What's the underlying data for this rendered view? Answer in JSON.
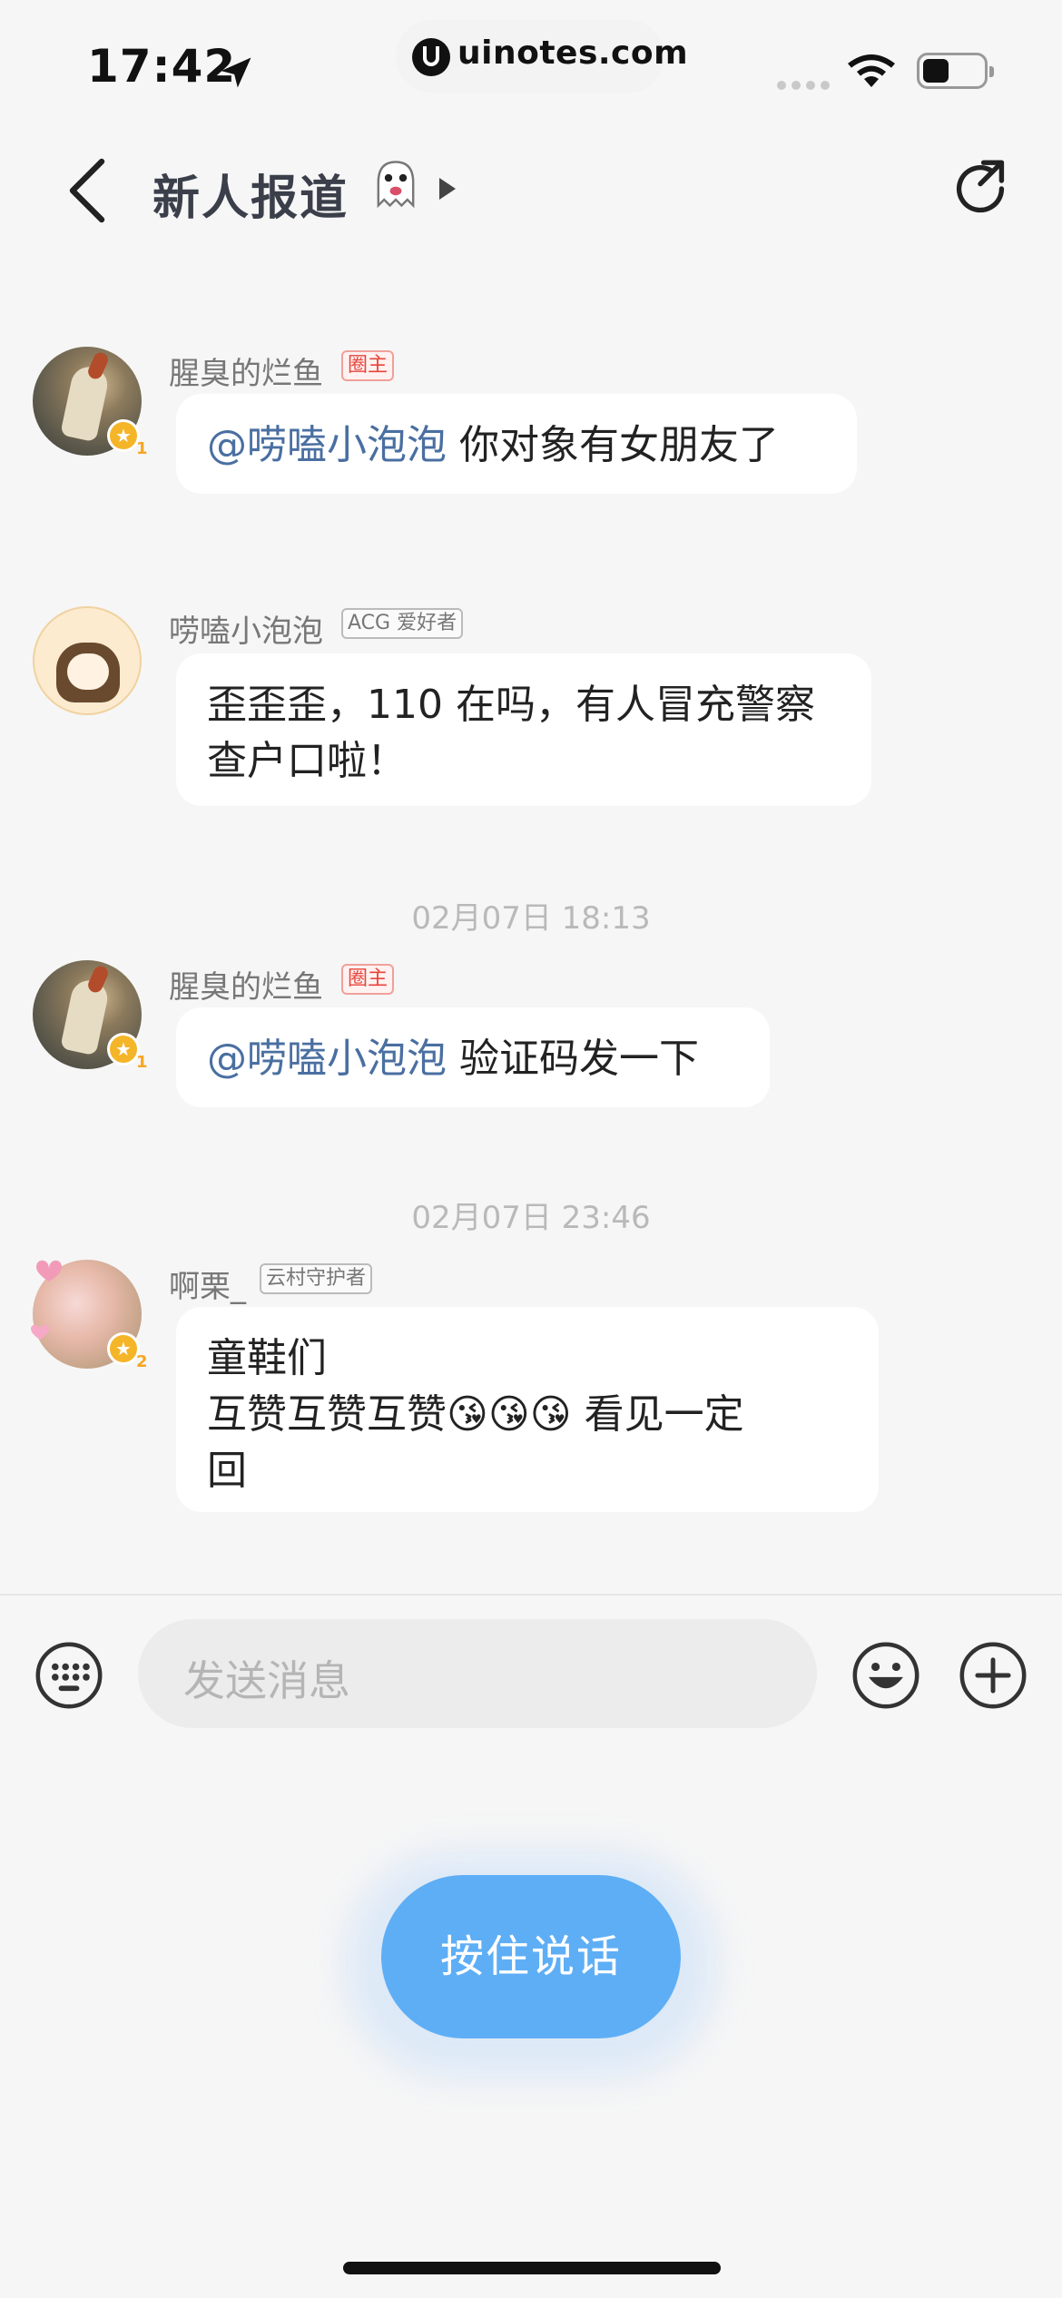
{
  "status_bar": {
    "time": "17:42",
    "url": "uinotes.com"
  },
  "header": {
    "title": "新人报道",
    "title_emoji": "👻"
  },
  "messages": [
    {
      "sender": "腥臭的烂鱼",
      "tag": "圈主",
      "badge_level": "1",
      "mention": "@唠嗑小泡泡",
      "text": " 你对象有女朋友了"
    },
    {
      "sender": "唠嗑小泡泡",
      "tag": "ACG 爱好者",
      "text_line1": "歪歪歪，110 在吗，有人冒充警察",
      "text_line2": "查户口啦！"
    },
    {
      "timestamp": "02月07日 18:13"
    },
    {
      "sender": "腥臭的烂鱼",
      "tag": "圈主",
      "badge_level": "1",
      "mention": "@唠嗑小泡泡",
      "text": " 验证码发一下"
    },
    {
      "timestamp": "02月07日 23:46"
    },
    {
      "sender": "啊栗_",
      "tag": "云村守护者",
      "badge_level": "2",
      "text_line1": "童鞋们",
      "text_line2": "互赞互赞互赞😘😘😘  看见一定",
      "text_line3": "回"
    }
  ],
  "input_bar": {
    "placeholder": "发送消息"
  },
  "voice_button": {
    "label": "按住说话"
  },
  "colors": {
    "mention": "#4a6fa1",
    "voice_button": "#5eaef6",
    "tag_red": "#e8443a"
  }
}
